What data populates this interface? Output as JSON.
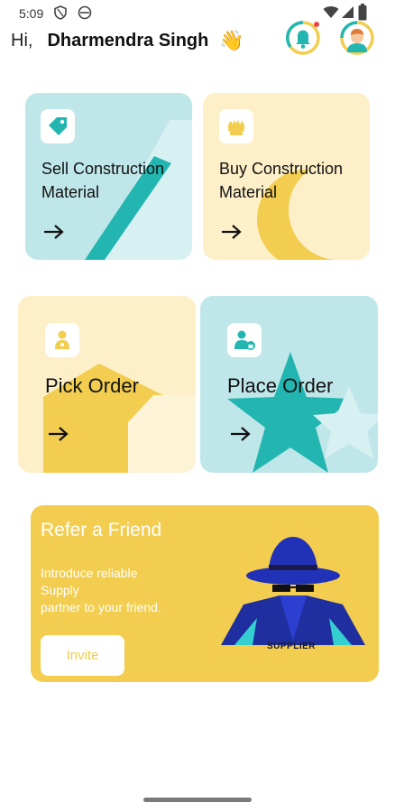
{
  "status_bar": {
    "time": "5:09"
  },
  "header": {
    "greeting": "Hi,",
    "user_name": "Dharmendra Singh",
    "wave": "👋"
  },
  "cards": {
    "sell": {
      "line1": "Sell Construction",
      "line2": "Material",
      "color": "#bfe6e9",
      "accent": "#23b6b1"
    },
    "buy": {
      "line1": "Buy Construction",
      "line2": "Material",
      "color": "#fdf0c8",
      "accent": "#f2cd4f"
    },
    "pick": {
      "label": "Pick Order",
      "color": "#fdf0c8",
      "accent": "#f2cd4f"
    },
    "place": {
      "label": "Place Order",
      "color": "#bfe6e9",
      "accent": "#23b6b1"
    }
  },
  "refer": {
    "title": "Refer a Friend",
    "line1": "Introduce reliable",
    "line2": "Supply",
    "line3": "partner to your friend.",
    "invite_label": "Invite",
    "illustration_label": "SUPPLIER",
    "color": "#f2cd4f"
  },
  "icons": [
    "signal-icon",
    "wifi-icon",
    "battery-icon",
    "notification-bell-icon",
    "avatar",
    "tag-icon",
    "hands-icon",
    "person-icon",
    "user-lock-icon",
    "arrow-right-icon"
  ]
}
